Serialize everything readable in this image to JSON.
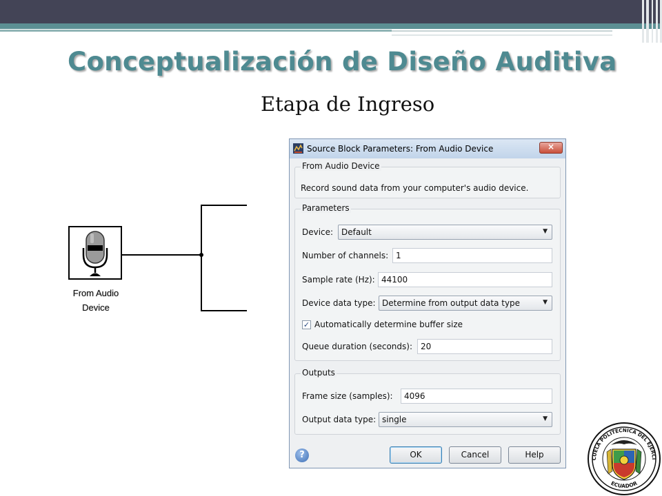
{
  "slide": {
    "title": "Conceptualización de Diseño Auditiva",
    "subtitle": "Etapa de Ingreso"
  },
  "diagram": {
    "block_caption_line1": "From Audio",
    "block_caption_line2": "Device"
  },
  "dialog": {
    "title": "Source Block Parameters: From Audio Device",
    "close_symbol": "×",
    "group_info": {
      "label": "From Audio Device",
      "description": "Record sound data from your computer's audio device."
    },
    "group_parameters": {
      "label": "Parameters",
      "device_label": "Device:",
      "device_value": "Default",
      "channels_label": "Number of channels:",
      "channels_value": "1",
      "sample_rate_label": "Sample rate (Hz):",
      "sample_rate_value": "44100",
      "data_type_label": "Device data type:",
      "data_type_value": "Determine from output data type",
      "auto_buffer_label": "Automatically determine buffer size",
      "auto_buffer_checked": true,
      "queue_label": "Queue duration (seconds):",
      "queue_value": "20"
    },
    "group_outputs": {
      "label": "Outputs",
      "frame_size_label": "Frame size (samples):",
      "frame_size_value": "4096",
      "output_type_label": "Output data type:",
      "output_type_value": "single"
    },
    "buttons": {
      "help_icon": "?",
      "ok": "OK",
      "cancel": "Cancel",
      "help": "Help"
    }
  },
  "seal": {
    "top_text": "ESCUELA POLITECNICA DEL EJERCITO",
    "bottom_text": "ECUADOR"
  },
  "colors": {
    "title": "#4e8a91",
    "top_bar": "#434456",
    "teal_bar": "#5c8f93",
    "dialog_bg": "#eef0f2"
  }
}
